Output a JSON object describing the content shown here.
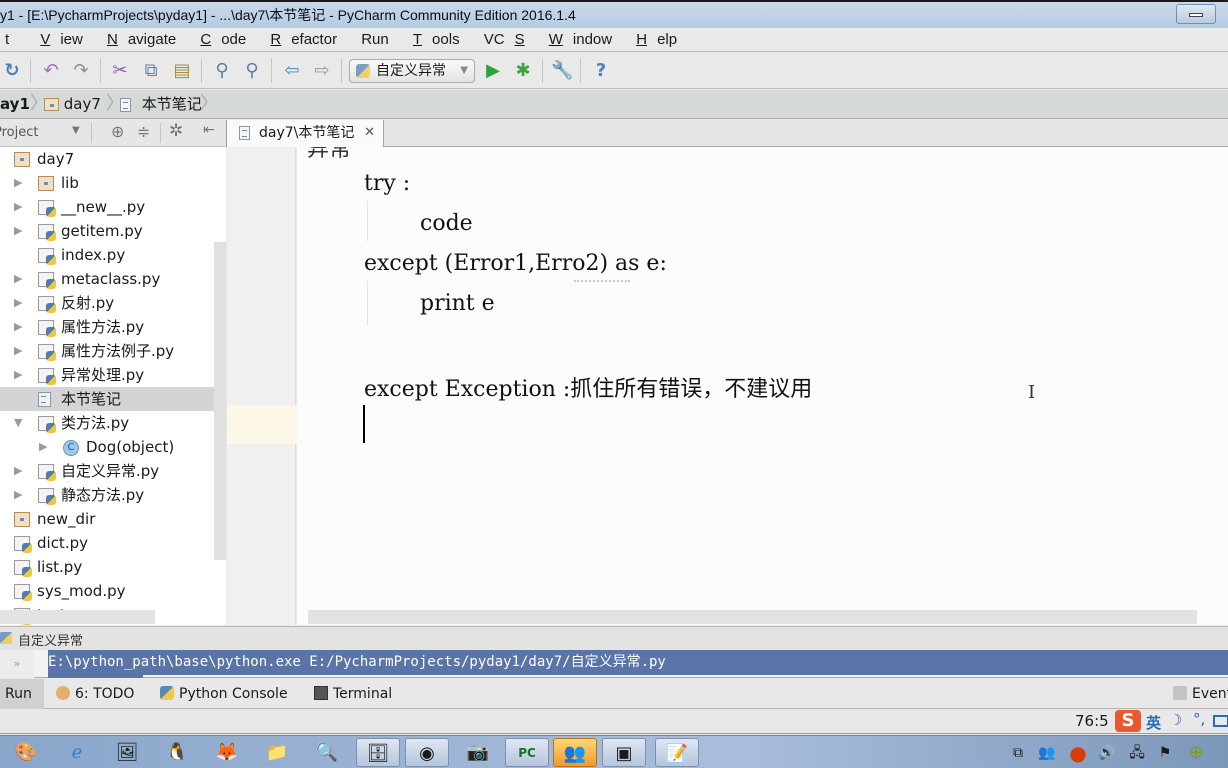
{
  "window": {
    "title": "y1 - [E:\\PycharmProjects\\pyday1] - ...\\day7\\本节笔记 - PyCharm Community Edition 2016.1.4"
  },
  "menu": [
    {
      "label": "t",
      "mn": ""
    },
    {
      "label": "iew",
      "mn": "V"
    },
    {
      "label": "avigate",
      "mn": "N"
    },
    {
      "label": "ode",
      "mn": "C"
    },
    {
      "label": "efactor",
      "mn": "R"
    },
    {
      "label": "n",
      "mn": "Ru"
    },
    {
      "label": "ools",
      "mn": "T"
    },
    {
      "label": "VC",
      "mn": "S"
    },
    {
      "label": "indow",
      "mn": "W"
    },
    {
      "label": "elp",
      "mn": "H"
    }
  ],
  "menu_full": [
    "t",
    "View",
    "Navigate",
    "Code",
    "Refactor",
    "Run",
    "Tools",
    "VCS",
    "Window",
    "Help"
  ],
  "toolbar": {
    "run_config": "自定义异常",
    "icons": [
      "sync-icon",
      "undo-icon",
      "redo-icon",
      "cut-icon",
      "copy-icon",
      "paste-icon",
      "find-icon",
      "replace-icon",
      "back-icon",
      "forward-icon",
      "run-icon",
      "debug-icon",
      "settings-icon",
      "help-icon"
    ]
  },
  "breadcrumb": [
    "ay1",
    "day7",
    "本节笔记"
  ],
  "project_panel": {
    "title": "Project",
    "tree": [
      {
        "label": "day7",
        "type": "folder",
        "depth": 0,
        "arrow": ""
      },
      {
        "label": "lib",
        "type": "folder",
        "depth": 1,
        "arrow": "▶"
      },
      {
        "label": "__new__.py",
        "type": "py",
        "depth": 1,
        "arrow": "▶"
      },
      {
        "label": "getitem.py",
        "type": "py",
        "depth": 1,
        "arrow": "▶"
      },
      {
        "label": "index.py",
        "type": "py",
        "depth": 1,
        "arrow": ""
      },
      {
        "label": "metaclass.py",
        "type": "py",
        "depth": 1,
        "arrow": "▶"
      },
      {
        "label": "反射.py",
        "type": "py",
        "depth": 1,
        "arrow": "▶"
      },
      {
        "label": "属性方法.py",
        "type": "py",
        "depth": 1,
        "arrow": "▶"
      },
      {
        "label": "属性方法例子.py",
        "type": "py",
        "depth": 1,
        "arrow": "▶"
      },
      {
        "label": "异常处理.py",
        "type": "py",
        "depth": 1,
        "arrow": "▶"
      },
      {
        "label": "本节笔记",
        "type": "txt",
        "depth": 1,
        "arrow": "",
        "selected": true
      },
      {
        "label": "类方法.py",
        "type": "py",
        "depth": 1,
        "arrow": "▼"
      },
      {
        "label": "Dog(object)",
        "type": "class",
        "depth": 2,
        "arrow": "▶"
      },
      {
        "label": "自定义异常.py",
        "type": "py",
        "depth": 1,
        "arrow": "▶"
      },
      {
        "label": "静态方法.py",
        "type": "py",
        "depth": 1,
        "arrow": "▶"
      },
      {
        "label": "new_dir",
        "type": "folder",
        "depth": 0,
        "arrow": ""
      },
      {
        "label": "dict.py",
        "type": "py",
        "depth": 0,
        "arrow": ""
      },
      {
        "label": "list.py",
        "type": "py",
        "depth": 0,
        "arrow": ""
      },
      {
        "label": "sys_mod.py",
        "type": "py",
        "depth": 0,
        "arrow": ""
      },
      {
        "label": "test.py",
        "type": "py",
        "depth": 0,
        "arrow": ""
      }
    ]
  },
  "editor": {
    "tab_label": "day7\\本节笔记",
    "lines": [
      {
        "text": "try :",
        "indent": 0
      },
      {
        "text": "code",
        "indent": 1
      },
      {
        "text": "except (Error1,Erro2) as e:",
        "indent": 0
      },
      {
        "text": "print e",
        "indent": 1
      },
      {
        "text": "",
        "indent": 0
      },
      {
        "text": "except Exception :抓住所有错误，不建议用",
        "indent": 0
      },
      {
        "text": "",
        "indent": 0
      }
    ],
    "partial_top_line": "异常"
  },
  "run_panel": {
    "title": "自定义异常",
    "command": "E:\\python_path\\base\\python.exe E:/PycharmProjects/pyday1/day7/自定义异常.py",
    "gutter": "»"
  },
  "tool_windows": [
    {
      "label": "Run",
      "name": "tool-window-run",
      "active": true
    },
    {
      "label": "6: TODO",
      "name": "tool-window-todo"
    },
    {
      "label": "Python Console",
      "name": "tool-window-python-console"
    },
    {
      "label": "Terminal",
      "name": "tool-window-terminal"
    }
  ],
  "event_log": "Event",
  "status": {
    "caret_position": "76:5",
    "ime": {
      "logo": "S",
      "mode": "英",
      "moon": "☽",
      "punct": "°,"
    }
  },
  "taskbar": {
    "apps": [
      "start-icon",
      "ie-icon",
      "media-icon",
      "qq-icon",
      "firefox-icon",
      "explorer-icon",
      "search-window-icon",
      "archive-icon",
      "chrome-icon",
      "camera-icon",
      "pycharm-icon",
      "contacts-icon",
      "vm-icon",
      "notepad-icon"
    ]
  }
}
